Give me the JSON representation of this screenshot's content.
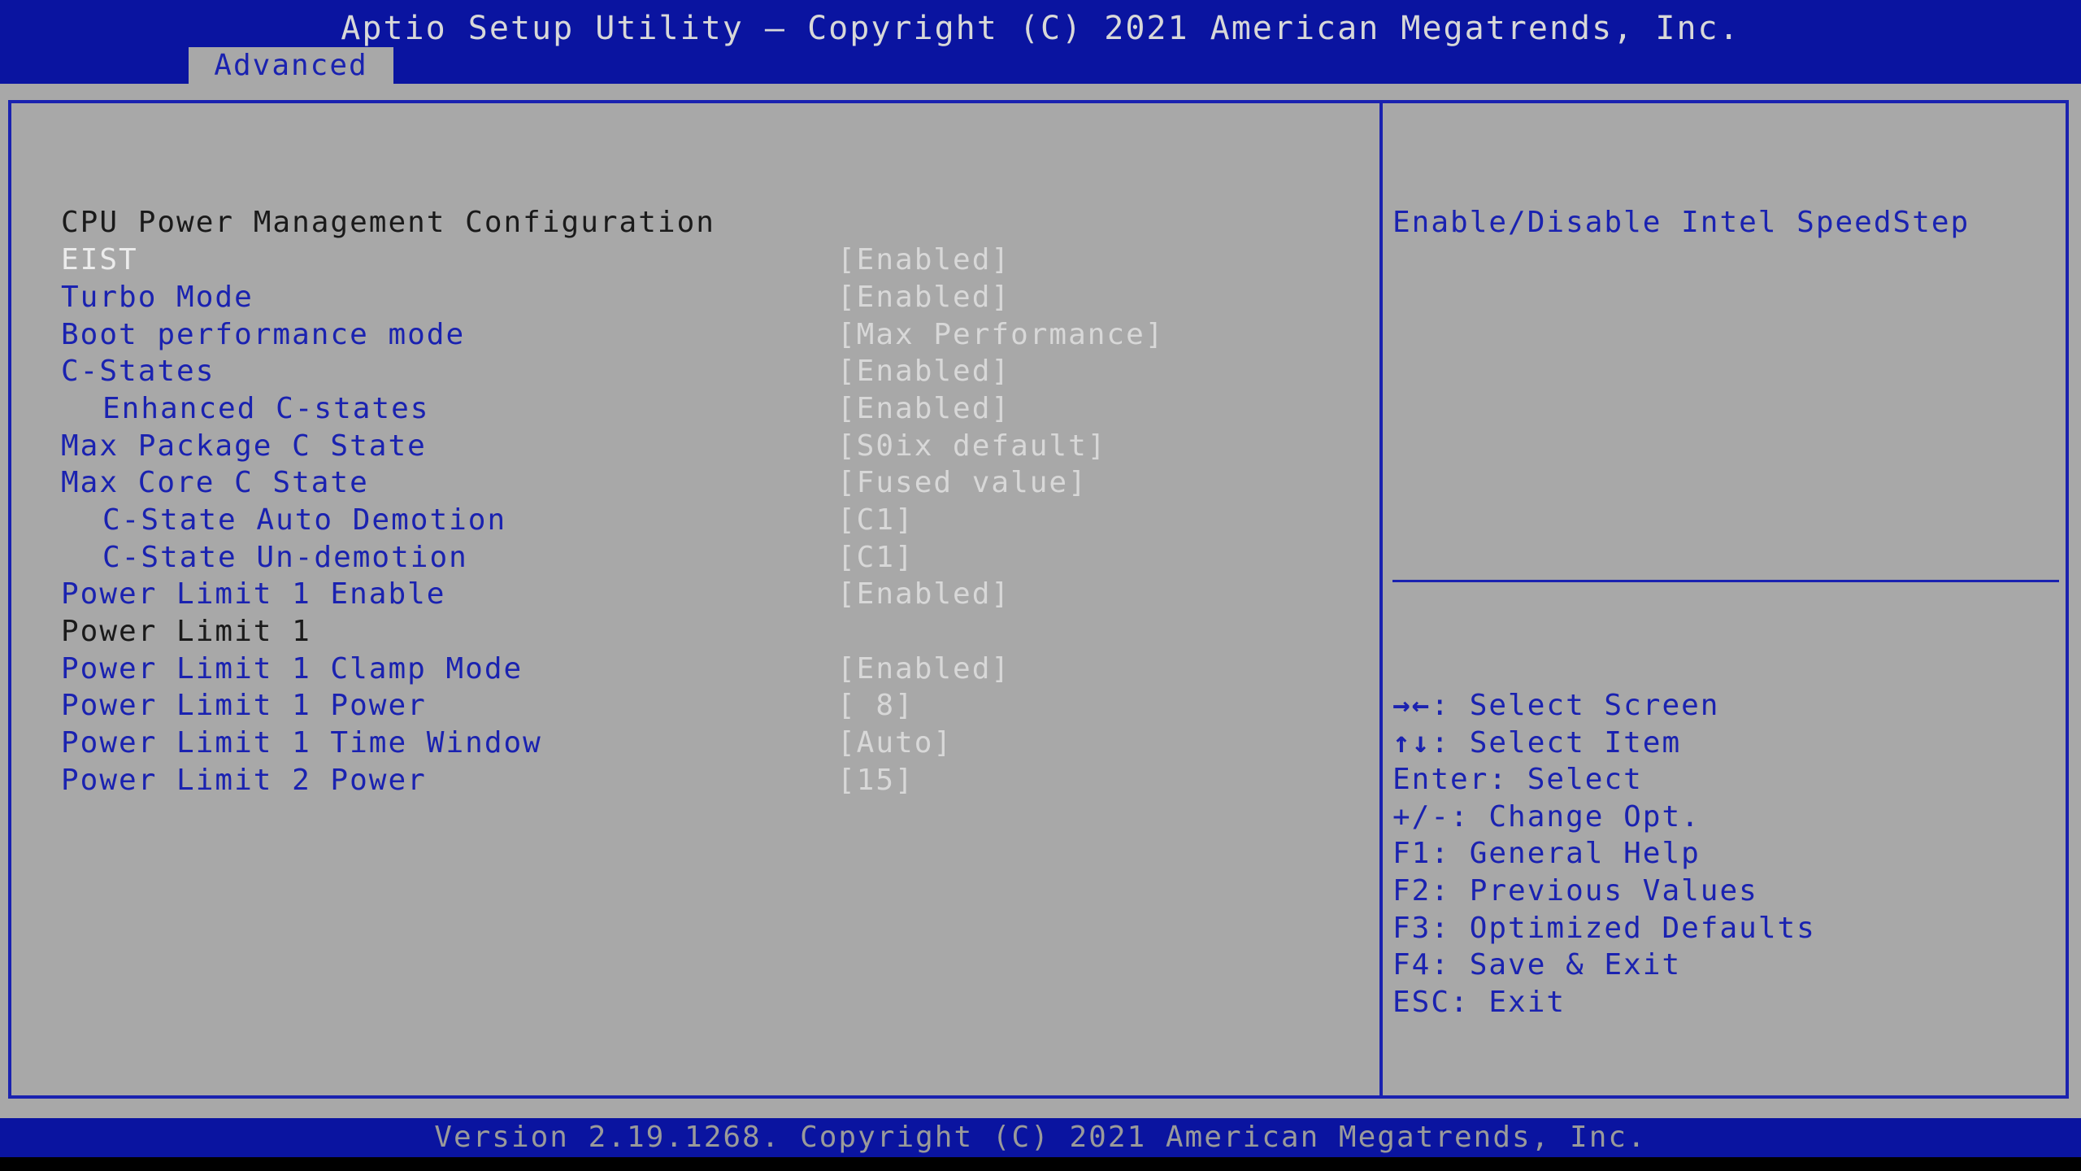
{
  "header": {
    "title": "Aptio Setup Utility – Copyright (C) 2021 American Megatrends, Inc.",
    "active_tab": "Advanced"
  },
  "section": {
    "title": "CPU Power Management Configuration"
  },
  "settings": [
    {
      "label": "EIST",
      "value": "[Enabled]"
    },
    {
      "label": "Turbo Mode",
      "value": "[Enabled]"
    },
    {
      "label": "Boot performance mode",
      "value": "[Max Performance]"
    },
    {
      "label": "C-States",
      "value": "[Enabled]"
    },
    {
      "label": "Enhanced C-states",
      "value": "[Enabled]"
    },
    {
      "label": "Max Package C State",
      "value": "[S0ix default]"
    },
    {
      "label": "Max Core C State",
      "value": "[Fused value]"
    },
    {
      "label": "C-State Auto Demotion",
      "value": "[C1]"
    },
    {
      "label": "C-State Un-demotion",
      "value": "[C1]"
    },
    {
      "label": "Power Limit 1 Enable",
      "value": "[Enabled]"
    },
    {
      "label": "Power Limit 1",
      "value": ""
    },
    {
      "label": "Power Limit 1 Clamp Mode",
      "value": "[Enabled]"
    },
    {
      "label": "Power Limit 1 Power",
      "value": "[ 8]"
    },
    {
      "label": "Power Limit 1 Time Window",
      "value": "[Auto]"
    },
    {
      "label": "Power Limit 2 Power",
      "value": "[15]"
    }
  ],
  "help": {
    "text": "Enable/Disable Intel SpeedStep"
  },
  "keys": [
    {
      "key": "→←",
      "desc": ": Select Screen"
    },
    {
      "key": "↑↓",
      "desc": ": Select Item"
    },
    {
      "key": "Enter",
      "desc": ": Select"
    },
    {
      "key": "+/-",
      "desc": ": Change Opt."
    },
    {
      "key": "F1",
      "desc": ": General Help"
    },
    {
      "key": "F2",
      "desc": ": Previous Values"
    },
    {
      "key": "F3",
      "desc": ": Optimized Defaults"
    },
    {
      "key": "F4",
      "desc": ": Save & Exit"
    },
    {
      "key": "ESC",
      "desc": ": Exit"
    }
  ],
  "footer": {
    "version": "Version 2.19.1268. Copyright (C) 2021 American Megatrends, Inc."
  },
  "colors": {
    "bar_blue": "#0a14a0",
    "panel_gray": "#a8a8a8",
    "text_blue": "#1a22b0",
    "text_white": "#d8d8d8",
    "selected_white": "#ececec"
  }
}
